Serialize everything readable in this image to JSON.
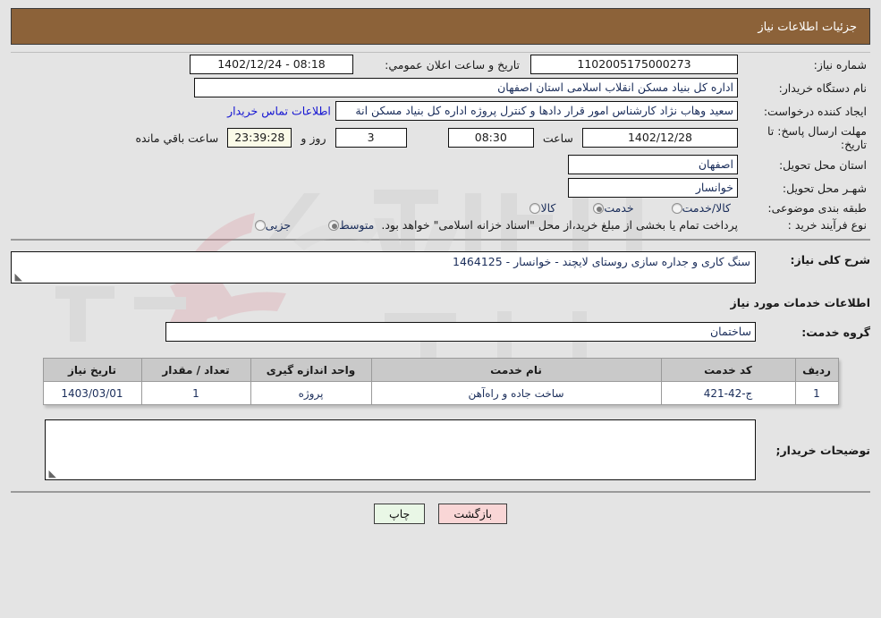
{
  "header": {
    "title": "جزئیات اطلاعات نیاز"
  },
  "fields": {
    "need_number_label": "شماره نیاز:",
    "need_number_value": "1102005175000273",
    "announce_label": "تاریخ و ساعت اعلان عمومي:",
    "announce_value": "08:18 - 1402/12/24",
    "buyer_org_label": "نام دستگاه خریدار:",
    "buyer_org_value": "اداره کل بنیاد مسکن انقلاب اسلامی استان اصفهان",
    "creator_label": "ایجاد کننده درخواست:",
    "creator_value": "سعید وهاب نژاد کارشناس امور قرار دادها و کنترل  پروژه اداره کل بنیاد مسکن انة",
    "contact_link": "اطلاعات تماس خریدار",
    "deadline_label": "مهلت ارسال پاسخ: تا تاریخ:",
    "deadline_date": "1402/12/28",
    "deadline_hour_label": "ساعت",
    "deadline_hour_value": "08:30",
    "remaining_days": "3",
    "remaining_days_label": "روز و",
    "remaining_time": "23:39:28",
    "remaining_suffix": "ساعت باقي مانده",
    "province_label": "استان محل تحویل:",
    "province_value": "اصفهان",
    "city_label": "شهـر محل تحویل:",
    "city_value": "خوانسار",
    "category_label": "طبقه بندی موضوعی:",
    "process_label": "نوع فرآیند خرید :",
    "process_note": "پرداخت تمام یا بخشی از مبلغ خرید،از محل \"اسناد خزانه اسلامی\" خواهد بود."
  },
  "category_options": [
    {
      "label": "کالا",
      "selected": false
    },
    {
      "label": "خدمت",
      "selected": true
    },
    {
      "label": "کالا/خدمت",
      "selected": false
    }
  ],
  "process_options": [
    {
      "label": "جزیی",
      "selected": false
    },
    {
      "label": "متوسط",
      "selected": true
    }
  ],
  "description": {
    "label": "شرح کلی نیاز:",
    "value": "سنگ کاری و جداره سازی روستای لایچند - خوانسار - 1464125"
  },
  "services": {
    "section_title": "اطلاعات خدمات مورد نیاز",
    "group_label": "گروه خدمت:",
    "group_value": "ساختمان",
    "columns": [
      "ردیف",
      "کد خدمت",
      "نام خدمت",
      "واحد اندازه گیری",
      "تعداد / مقدار",
      "تاریخ نیاز"
    ],
    "rows": [
      {
        "index": "1",
        "code": "ج-42-421",
        "name": "ساخت جاده و راه‌آهن",
        "unit": "پروژه",
        "quantity": "1",
        "date": "1403/03/01"
      }
    ]
  },
  "buyer_notes": {
    "label": "توضیحات خریدار;",
    "value": ""
  },
  "footer": {
    "print_label": "چاپ",
    "back_label": "بازگشت"
  },
  "colors": {
    "header_bg": "#8c6239",
    "page_bg": "#e4e4e4",
    "link": "#1414d2",
    "table_header_bg": "#c9c9c9",
    "print_bg": "#e9f7e6",
    "back_bg": "#f9d6d6",
    "countdown_bg": "#fbfbe8"
  },
  "watermark": {
    "text": "AriaTender.net"
  }
}
